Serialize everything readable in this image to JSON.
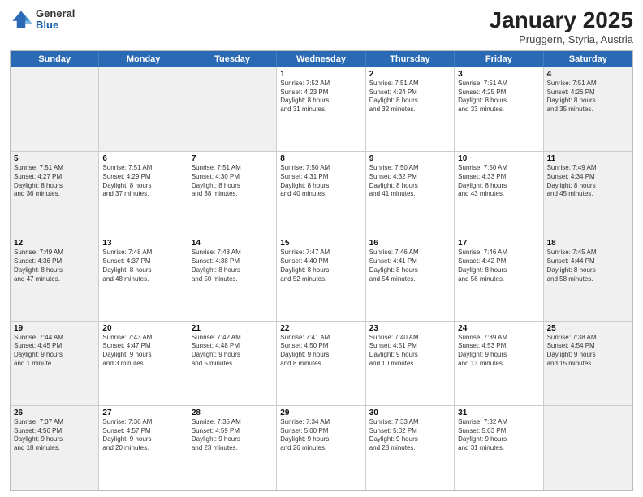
{
  "header": {
    "logo_general": "General",
    "logo_blue": "Blue",
    "title": "January 2025",
    "subtitle": "Pruggern, Styria, Austria"
  },
  "days_of_week": [
    "Sunday",
    "Monday",
    "Tuesday",
    "Wednesday",
    "Thursday",
    "Friday",
    "Saturday"
  ],
  "weeks": [
    [
      {
        "day": "",
        "info": "",
        "shaded": true
      },
      {
        "day": "",
        "info": "",
        "shaded": true
      },
      {
        "day": "",
        "info": "",
        "shaded": true
      },
      {
        "day": "1",
        "info": "Sunrise: 7:52 AM\nSunset: 4:23 PM\nDaylight: 8 hours\nand 31 minutes."
      },
      {
        "day": "2",
        "info": "Sunrise: 7:51 AM\nSunset: 4:24 PM\nDaylight: 8 hours\nand 32 minutes."
      },
      {
        "day": "3",
        "info": "Sunrise: 7:51 AM\nSunset: 4:25 PM\nDaylight: 8 hours\nand 33 minutes."
      },
      {
        "day": "4",
        "info": "Sunrise: 7:51 AM\nSunset: 4:26 PM\nDaylight: 8 hours\nand 35 minutes.",
        "shaded": true
      }
    ],
    [
      {
        "day": "5",
        "info": "Sunrise: 7:51 AM\nSunset: 4:27 PM\nDaylight: 8 hours\nand 36 minutes.",
        "shaded": true
      },
      {
        "day": "6",
        "info": "Sunrise: 7:51 AM\nSunset: 4:29 PM\nDaylight: 8 hours\nand 37 minutes."
      },
      {
        "day": "7",
        "info": "Sunrise: 7:51 AM\nSunset: 4:30 PM\nDaylight: 8 hours\nand 38 minutes."
      },
      {
        "day": "8",
        "info": "Sunrise: 7:50 AM\nSunset: 4:31 PM\nDaylight: 8 hours\nand 40 minutes."
      },
      {
        "day": "9",
        "info": "Sunrise: 7:50 AM\nSunset: 4:32 PM\nDaylight: 8 hours\nand 41 minutes."
      },
      {
        "day": "10",
        "info": "Sunrise: 7:50 AM\nSunset: 4:33 PM\nDaylight: 8 hours\nand 43 minutes."
      },
      {
        "day": "11",
        "info": "Sunrise: 7:49 AM\nSunset: 4:34 PM\nDaylight: 8 hours\nand 45 minutes.",
        "shaded": true
      }
    ],
    [
      {
        "day": "12",
        "info": "Sunrise: 7:49 AM\nSunset: 4:36 PM\nDaylight: 8 hours\nand 47 minutes.",
        "shaded": true
      },
      {
        "day": "13",
        "info": "Sunrise: 7:48 AM\nSunset: 4:37 PM\nDaylight: 8 hours\nand 48 minutes."
      },
      {
        "day": "14",
        "info": "Sunrise: 7:48 AM\nSunset: 4:38 PM\nDaylight: 8 hours\nand 50 minutes."
      },
      {
        "day": "15",
        "info": "Sunrise: 7:47 AM\nSunset: 4:40 PM\nDaylight: 8 hours\nand 52 minutes."
      },
      {
        "day": "16",
        "info": "Sunrise: 7:46 AM\nSunset: 4:41 PM\nDaylight: 8 hours\nand 54 minutes."
      },
      {
        "day": "17",
        "info": "Sunrise: 7:46 AM\nSunset: 4:42 PM\nDaylight: 8 hours\nand 56 minutes."
      },
      {
        "day": "18",
        "info": "Sunrise: 7:45 AM\nSunset: 4:44 PM\nDaylight: 8 hours\nand 58 minutes.",
        "shaded": true
      }
    ],
    [
      {
        "day": "19",
        "info": "Sunrise: 7:44 AM\nSunset: 4:45 PM\nDaylight: 9 hours\nand 1 minute.",
        "shaded": true
      },
      {
        "day": "20",
        "info": "Sunrise: 7:43 AM\nSunset: 4:47 PM\nDaylight: 9 hours\nand 3 minutes."
      },
      {
        "day": "21",
        "info": "Sunrise: 7:42 AM\nSunset: 4:48 PM\nDaylight: 9 hours\nand 5 minutes."
      },
      {
        "day": "22",
        "info": "Sunrise: 7:41 AM\nSunset: 4:50 PM\nDaylight: 9 hours\nand 8 minutes."
      },
      {
        "day": "23",
        "info": "Sunrise: 7:40 AM\nSunset: 4:51 PM\nDaylight: 9 hours\nand 10 minutes."
      },
      {
        "day": "24",
        "info": "Sunrise: 7:39 AM\nSunset: 4:53 PM\nDaylight: 9 hours\nand 13 minutes."
      },
      {
        "day": "25",
        "info": "Sunrise: 7:38 AM\nSunset: 4:54 PM\nDaylight: 9 hours\nand 15 minutes.",
        "shaded": true
      }
    ],
    [
      {
        "day": "26",
        "info": "Sunrise: 7:37 AM\nSunset: 4:56 PM\nDaylight: 9 hours\nand 18 minutes.",
        "shaded": true
      },
      {
        "day": "27",
        "info": "Sunrise: 7:36 AM\nSunset: 4:57 PM\nDaylight: 9 hours\nand 20 minutes."
      },
      {
        "day": "28",
        "info": "Sunrise: 7:35 AM\nSunset: 4:59 PM\nDaylight: 9 hours\nand 23 minutes."
      },
      {
        "day": "29",
        "info": "Sunrise: 7:34 AM\nSunset: 5:00 PM\nDaylight: 9 hours\nand 26 minutes."
      },
      {
        "day": "30",
        "info": "Sunrise: 7:33 AM\nSunset: 5:02 PM\nDaylight: 9 hours\nand 28 minutes."
      },
      {
        "day": "31",
        "info": "Sunrise: 7:32 AM\nSunset: 5:03 PM\nDaylight: 9 hours\nand 31 minutes."
      },
      {
        "day": "",
        "info": "",
        "shaded": true
      }
    ]
  ]
}
